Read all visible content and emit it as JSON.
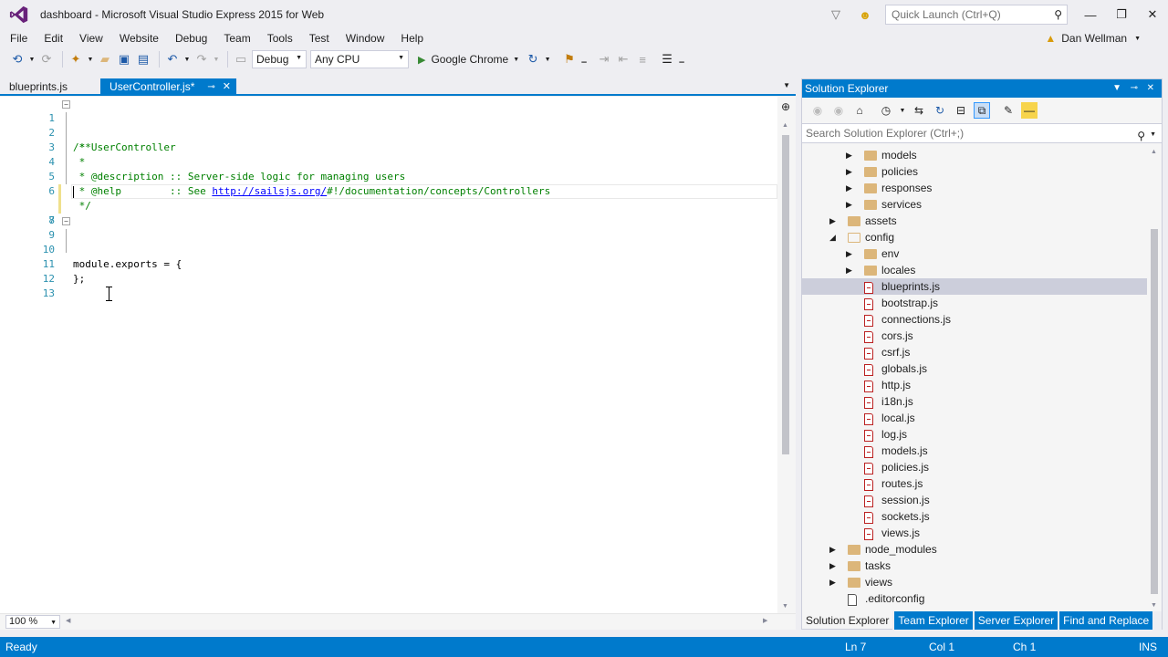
{
  "window": {
    "title": "dashboard - Microsoft Visual Studio Express 2015 for Web",
    "quick_launch_placeholder": "Quick Launch (Ctrl+Q)"
  },
  "menu": [
    "File",
    "Edit",
    "View",
    "Website",
    "Debug",
    "Team",
    "Tools",
    "Test",
    "Window",
    "Help"
  ],
  "user": {
    "name": "Dan Wellman"
  },
  "toolbar": {
    "configuration": "Debug",
    "platform": "Any CPU",
    "run_target": "Google Chrome"
  },
  "doc_tabs": [
    {
      "label": "blueprints.js",
      "active": false
    },
    {
      "label": "UserController.js*",
      "active": true
    }
  ],
  "editor": {
    "lines": [
      {
        "n": "1",
        "text": "/**"
      },
      {
        "n": "2",
        "text": " * UserController"
      },
      {
        "n": "3",
        "text": " *"
      },
      {
        "n": "4",
        "text": " * @description :: Server-side logic for managing users"
      },
      {
        "n": "5",
        "text_a": " * @help        :: See ",
        "link": "http://sailsjs.org/",
        "text_b": "#!/documentation/concepts/Controllers"
      },
      {
        "n": "6",
        "text": " */"
      },
      {
        "n": "7",
        "text": ""
      },
      {
        "n": "8",
        "text": ""
      },
      {
        "n": "9",
        "text": "module.exports = {"
      },
      {
        "n": "10",
        "text": "    "
      },
      {
        "n": "11",
        "text": "};"
      },
      {
        "n": "12",
        "text": ""
      },
      {
        "n": "13",
        "text": ""
      }
    ],
    "zoom": "100 %"
  },
  "solution_explorer": {
    "title": "Solution Explorer",
    "search_placeholder": "Search Solution Explorer (Ctrl+;)",
    "items": [
      {
        "label": "models",
        "type": "folder",
        "level": 2,
        "expander": "collapsed"
      },
      {
        "label": "policies",
        "type": "folder",
        "level": 2,
        "expander": "collapsed"
      },
      {
        "label": "responses",
        "type": "folder",
        "level": 2,
        "expander": "collapsed"
      },
      {
        "label": "services",
        "type": "folder",
        "level": 2,
        "expander": "collapsed"
      },
      {
        "label": "assets",
        "type": "folder",
        "level": 1,
        "expander": "collapsed"
      },
      {
        "label": "config",
        "type": "folder-open",
        "level": 1,
        "expander": "expanded"
      },
      {
        "label": "env",
        "type": "folder",
        "level": 2,
        "expander": "collapsed"
      },
      {
        "label": "locales",
        "type": "folder",
        "level": 2,
        "expander": "collapsed"
      },
      {
        "label": "blueprints.js",
        "type": "file",
        "level": 2,
        "selected": true
      },
      {
        "label": "bootstrap.js",
        "type": "file",
        "level": 2
      },
      {
        "label": "connections.js",
        "type": "file",
        "level": 2
      },
      {
        "label": "cors.js",
        "type": "file",
        "level": 2
      },
      {
        "label": "csrf.js",
        "type": "file",
        "level": 2
      },
      {
        "label": "globals.js",
        "type": "file",
        "level": 2
      },
      {
        "label": "http.js",
        "type": "file",
        "level": 2
      },
      {
        "label": "i18n.js",
        "type": "file",
        "level": 2
      },
      {
        "label": "local.js",
        "type": "file",
        "level": 2
      },
      {
        "label": "log.js",
        "type": "file",
        "level": 2
      },
      {
        "label": "models.js",
        "type": "file",
        "level": 2
      },
      {
        "label": "policies.js",
        "type": "file",
        "level": 2
      },
      {
        "label": "routes.js",
        "type": "file",
        "level": 2
      },
      {
        "label": "session.js",
        "type": "file",
        "level": 2
      },
      {
        "label": "sockets.js",
        "type": "file",
        "level": 2
      },
      {
        "label": "views.js",
        "type": "file",
        "level": 2
      },
      {
        "label": "node_modules",
        "type": "folder",
        "level": 1,
        "expander": "collapsed"
      },
      {
        "label": "tasks",
        "type": "folder",
        "level": 1,
        "expander": "collapsed"
      },
      {
        "label": "views",
        "type": "folder",
        "level": 1,
        "expander": "collapsed"
      },
      {
        "label": ".editorconfig",
        "type": "plain-file",
        "level": 1
      }
    ],
    "bottom_tabs": [
      {
        "label": "Solution Explorer",
        "active": true
      },
      {
        "label": "Team Explorer",
        "active": false
      },
      {
        "label": "Server Explorer",
        "active": false
      },
      {
        "label": "Find and Replace",
        "active": false
      }
    ]
  },
  "status": {
    "state": "Ready",
    "line": "Ln 7",
    "col": "Col 1",
    "ch": "Ch 1",
    "mode": "INS"
  },
  "colors": {
    "accent": "#007acc",
    "comment": "#008000",
    "line_number": "#2b91af",
    "link": "#0000ff"
  }
}
